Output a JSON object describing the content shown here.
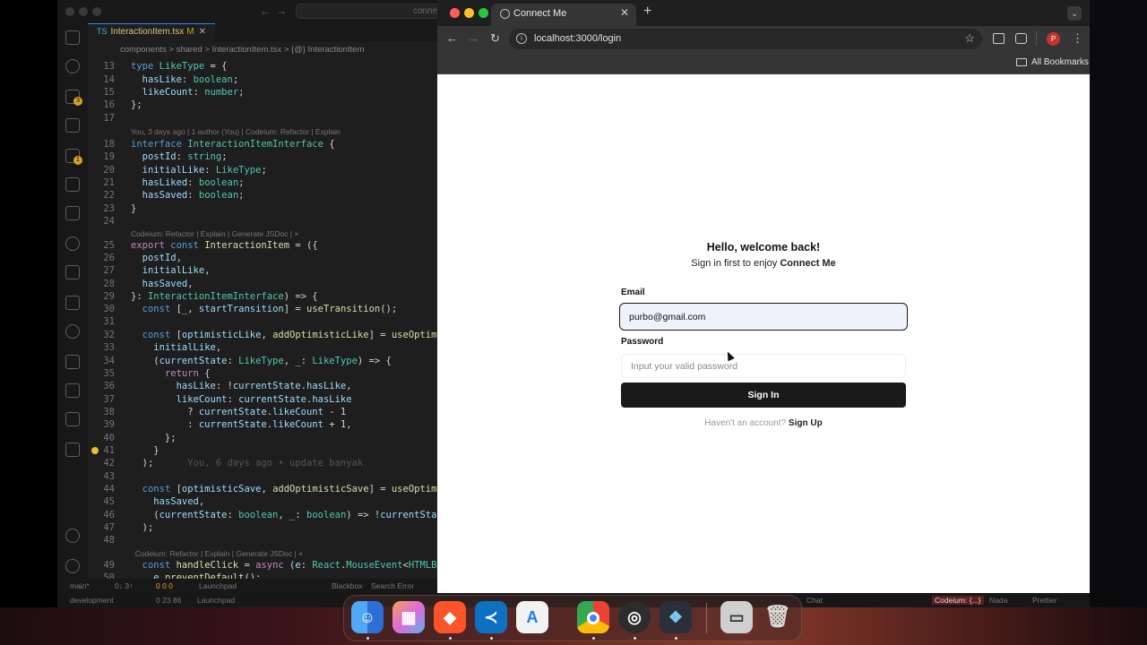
{
  "vscode": {
    "tab": {
      "label": "InteractionItem.tsx",
      "modified": "M"
    },
    "breadcrumb": "components  >  shared  >  InteractionItem.tsx  >  {@} InteractionItem",
    "search_text": "connec",
    "status_top": {
      "branch": "main*",
      "sync": "0↓ 3↑",
      "problems": "0  0  0",
      "launch": "Launchpad",
      "blackbox": "Blackbox",
      "search_error": "Search Error"
    },
    "status_bottom": {
      "branch": "development",
      "problems": "0  23  86",
      "launch": "Launchpad",
      "codeium": "Codeium: {...}",
      "nada": "Nada",
      "prettier": "Prettier",
      "chat": "Chat"
    }
  },
  "chrome": {
    "tab_title": "Connect Me",
    "url": "localhost:3000/login",
    "bookmarks_label": "All Bookmarks",
    "profile_initial": "P"
  },
  "login": {
    "greeting": "Hello, welcome back!",
    "subtitle_prefix": "Sign in first to enjoy ",
    "subtitle_brand": "Connect Me",
    "email_label": "Email",
    "email_value": "purbo@gmail.com",
    "password_label": "Password",
    "password_placeholder": "Input your valid password",
    "signin_label": "Sign In",
    "signup_prompt": "Haven't an account? ",
    "signup_link": "Sign Up"
  },
  "dock": {
    "apps": [
      "finder-icon",
      "launchpad-icon",
      "brave-icon",
      "vscode-icon",
      "xcode-instruments-icon",
      "chrome-icon",
      "obs-icon",
      "davinci-icon",
      "terminal-icon",
      "trash-icon"
    ]
  }
}
